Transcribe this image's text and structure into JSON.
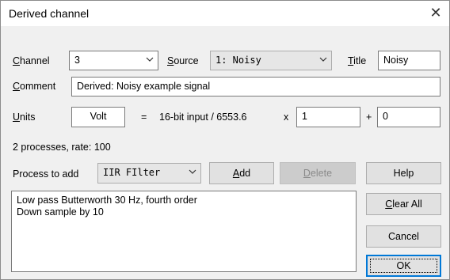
{
  "window": {
    "title": "Derived channel",
    "close_glyph": "✕"
  },
  "row1": {
    "channel_label_key": "C",
    "channel_label_rest": "hannel",
    "channel_value": "3",
    "source_label_key": "S",
    "source_label_rest": "ource",
    "source_value": "1: Noisy",
    "title_label_key": "T",
    "title_label_rest": "itle",
    "title_value": "Noisy"
  },
  "row2": {
    "comment_label_key": "C",
    "comment_label_rest": "omment",
    "comment_value": "Derived: Noisy example signal"
  },
  "row3": {
    "units_label_key": "U",
    "units_label_rest": "nits",
    "units_value": "Volt",
    "equals": "=",
    "formula": "16-bit input / 6553.6",
    "times": "x",
    "scale_value": "1",
    "plus": "+",
    "offset_value": "0"
  },
  "status": {
    "text": "2 processes, rate: 100"
  },
  "process": {
    "label": "Process to add",
    "value": "IIR FIlter"
  },
  "buttons": {
    "add_key": "A",
    "add_rest": "dd",
    "delete_key": "D",
    "delete_rest": "elete",
    "help": "Help",
    "clear_key": "C",
    "clear_rest": "lear All",
    "cancel": "Cancel",
    "ok": "OK"
  },
  "process_list": {
    "items": [
      "Low pass Butterworth 30 Hz, fourth order",
      "Down sample by 10"
    ]
  },
  "colors": {
    "accent": "#0078d7",
    "field_border": "#7a7a7a",
    "dialog_bg": "#f0f0f0"
  },
  "icons": {
    "close": "close-icon",
    "dropdown": "chevron-down-icon"
  }
}
